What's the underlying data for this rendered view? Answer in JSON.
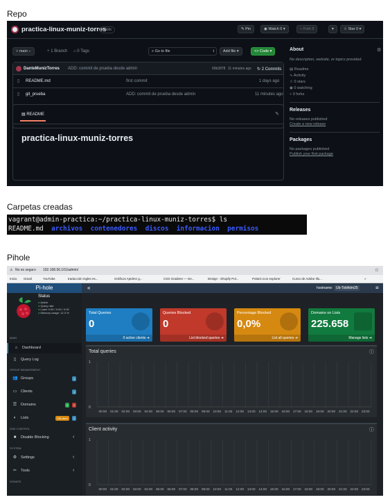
{
  "sections": {
    "repo": "Repo",
    "carpetas": "Carpetas creadas",
    "pihole": "Pihole"
  },
  "github": {
    "repo_name": "practica-linux-muniz-torres",
    "visibility": "Public",
    "buttons": {
      "pin": "Pin",
      "watch": "Watch",
      "watch_count": "0",
      "fork": "Fork",
      "fork_count": "0",
      "star": "Star",
      "star_count": "0"
    },
    "branch": "main",
    "branches": "1 Branch",
    "tags": "0 Tags",
    "goto_placeholder": "Go to file",
    "goto_key": "t",
    "add_file": "Add file",
    "code": "<> Code",
    "commit": {
      "author": "DanteMunizTorres",
      "message": "ADD: commit de prueba desde admin",
      "hash": "60b2878",
      "time": "11 minutes ago",
      "count": "2 Commits"
    },
    "files": [
      {
        "name": "README.md",
        "message": "first commit",
        "time": "1 days ago"
      },
      {
        "name": "git_prueba",
        "message": "ADD: commit de prueba desde admin",
        "time": "11 minutes ago"
      }
    ],
    "readme_tab": "README",
    "readme_title": "practica-linux-muniz-torres",
    "about": {
      "title": "About",
      "description": "No description, website, or topics provided.",
      "items": [
        "Readme",
        "Activity",
        "0 stars",
        "0 watching",
        "0 forks"
      ],
      "releases_title": "Releases",
      "releases_text": "No releases published",
      "releases_link": "Create a new release",
      "packages_title": "Packages",
      "packages_text": "No packages published",
      "packages_link": "Publish your first package"
    }
  },
  "terminal": {
    "prompt": "vagrant@admin-practica:~/practica-linux-muniz-torres$ ls",
    "file": "README.md",
    "dirs": [
      "archivos",
      "contenedores",
      "discos",
      "informacion",
      "permisos"
    ]
  },
  "pihole": {
    "browser": {
      "insecure": "No es seguro",
      "url": "192.168.56.101/admin/"
    },
    "bookmarks": [
      "Inicio",
      "Gmail",
      "YouTube",
      "traducción ingles es...",
      "Gráficos Ajedrez g...",
      "CSS Gradient — Ge...",
      "Design - Shopify Pol...",
      "Polaris icon explorer",
      "Curso de Adobe Illu..."
    ],
    "brand": "Pi-hole",
    "hostname_label": "hostname:",
    "hostname": "Ub-TsttAdm25",
    "status": {
      "title": "Status",
      "active": "Active",
      "query": "Query rate",
      "load": "Load: 0.00 / 0.00 / 0.00",
      "memory": "Memory usage: 12.3 %"
    },
    "menu_main": "MAIN",
    "menu_group": "GROUP MANAGEMENT",
    "menu_dns": "DNS CONTROL",
    "menu_system": "SYSTEM",
    "menu_donate": "DONATE",
    "menu": [
      {
        "label": "Dashboard",
        "icon": "home-icon"
      },
      {
        "label": "Query Log",
        "icon": "file-icon"
      },
      {
        "label": "Groups",
        "icon": "users-icon",
        "badge": "1"
      },
      {
        "label": "Clients",
        "icon": "laptop-icon",
        "badge": "1"
      },
      {
        "label": "Domains",
        "icon": "list-icon",
        "badge": "0",
        "badge2": "0"
      },
      {
        "label": "Lists",
        "icon": "shield-icon",
        "badge": "13k-dom",
        "badge2": "1"
      },
      {
        "label": "Disable Blocking",
        "icon": "stop-icon"
      },
      {
        "label": "Settings",
        "icon": "gear-icon"
      },
      {
        "label": "Tools",
        "icon": "tools-icon"
      }
    ],
    "boxes": [
      {
        "title": "Total Queries",
        "value": "0",
        "footer": "0 active clients",
        "color": "#1f7ec2"
      },
      {
        "title": "Queries Blocked",
        "value": "0",
        "footer": "List blocked queries",
        "color": "#c0392b"
      },
      {
        "title": "Percentage Blocked",
        "value": "0,0%",
        "footer": "List all queries",
        "color": "#d68910"
      },
      {
        "title": "Domains on Lists",
        "value": "225.658",
        "footer": "Manage lists",
        "color": "#117a3e"
      }
    ],
    "chart1_title": "Total queries",
    "chart2_title": "Client activity",
    "chart_ylabels": [
      "1",
      "0"
    ],
    "chart_times": [
      "00:00",
      "01:00",
      "02:00",
      "03:00",
      "04:00",
      "05:00",
      "06:00",
      "07:00",
      "08:00",
      "09:00",
      "10:00",
      "11:00",
      "12:00",
      "13:00",
      "14:00",
      "15:00",
      "16:00",
      "17:00",
      "18:00",
      "19:00",
      "20:00",
      "21:00",
      "22:00",
      "23:00"
    ]
  },
  "chart_data": [
    {
      "type": "bar",
      "title": "Total queries",
      "categories": [
        "00:00",
        "01:00",
        "02:00",
        "03:00",
        "04:00",
        "05:00",
        "06:00",
        "07:00",
        "08:00",
        "09:00",
        "10:00",
        "11:00",
        "12:00",
        "13:00",
        "14:00",
        "15:00",
        "16:00",
        "17:00",
        "18:00",
        "19:00",
        "20:00",
        "21:00",
        "22:00",
        "23:00"
      ],
      "values": [
        0,
        0,
        0,
        0,
        0,
        0,
        0,
        0,
        0,
        0,
        0,
        0,
        0,
        0,
        0,
        0,
        0,
        0,
        0,
        0,
        0,
        0,
        0,
        0
      ],
      "ylim": [
        0,
        1
      ]
    },
    {
      "type": "bar",
      "title": "Client activity",
      "categories": [
        "00:00",
        "01:00",
        "02:00",
        "03:00",
        "04:00",
        "05:00",
        "06:00",
        "07:00",
        "08:00",
        "09:00",
        "10:00",
        "11:00",
        "12:00",
        "13:00",
        "14:00",
        "15:00",
        "16:00",
        "17:00",
        "18:00",
        "19:00",
        "20:00",
        "21:00",
        "22:00",
        "23:00"
      ],
      "values": [
        0,
        0,
        0,
        0,
        0,
        0,
        0,
        0,
        0,
        0,
        0,
        0,
        0,
        0,
        0,
        0,
        0,
        0,
        0,
        0,
        0,
        0,
        0,
        0
      ],
      "ylim": [
        0,
        1
      ]
    }
  ]
}
